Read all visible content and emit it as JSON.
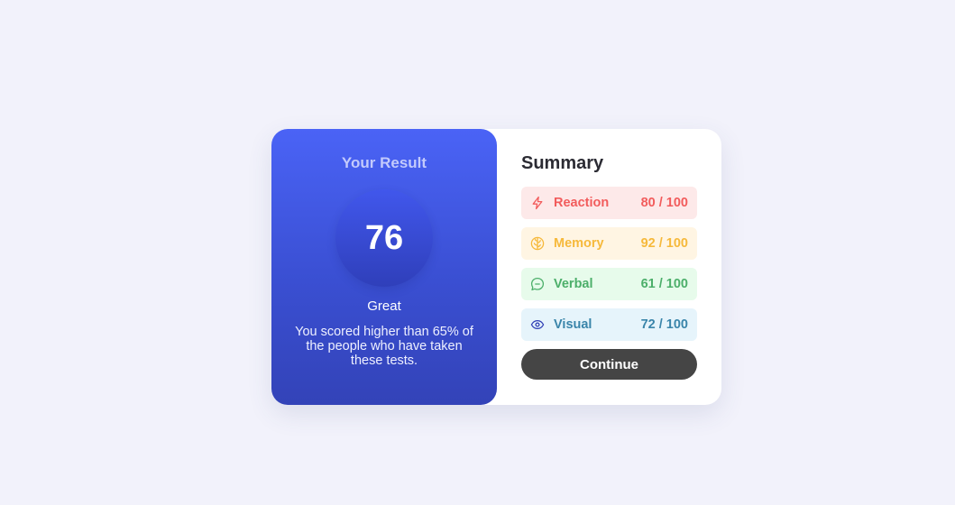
{
  "result": {
    "heading": "Your Result",
    "score": "76",
    "rating": "Great",
    "description": "You scored higher than 65% of the people who have taken these tests."
  },
  "summary": {
    "title": "Summary",
    "items": [
      {
        "label": "Reaction",
        "score": "80",
        "separator": "/",
        "max": "100",
        "value_text": "80 / 100",
        "icon": "lightning-icon",
        "color": "#f25c5c",
        "background": "#fde9e9"
      },
      {
        "label": "Memory",
        "score": "92",
        "separator": "/",
        "max": "100",
        "value_text": "92 / 100",
        "icon": "brain-icon",
        "color": "#f6b93b",
        "background": "#fff5e3"
      },
      {
        "label": "Verbal",
        "score": "61",
        "separator": "/",
        "max": "100",
        "value_text": "61 / 100",
        "icon": "chat-bubble-icon",
        "color": "#4caf6a",
        "background": "#e7fbeb"
      },
      {
        "label": "Visual",
        "score": "72",
        "separator": "/",
        "max": "100",
        "value_text": "72 / 100",
        "icon": "eye-icon",
        "color": "#3a85aa",
        "background": "#e6f4fb"
      }
    ],
    "continue_label": "Continue"
  },
  "colors": {
    "page_background": "#f2f2fb",
    "result_gradient_top": "#4a63f6",
    "result_gradient_bottom": "#3343b8",
    "button": "#454545"
  }
}
